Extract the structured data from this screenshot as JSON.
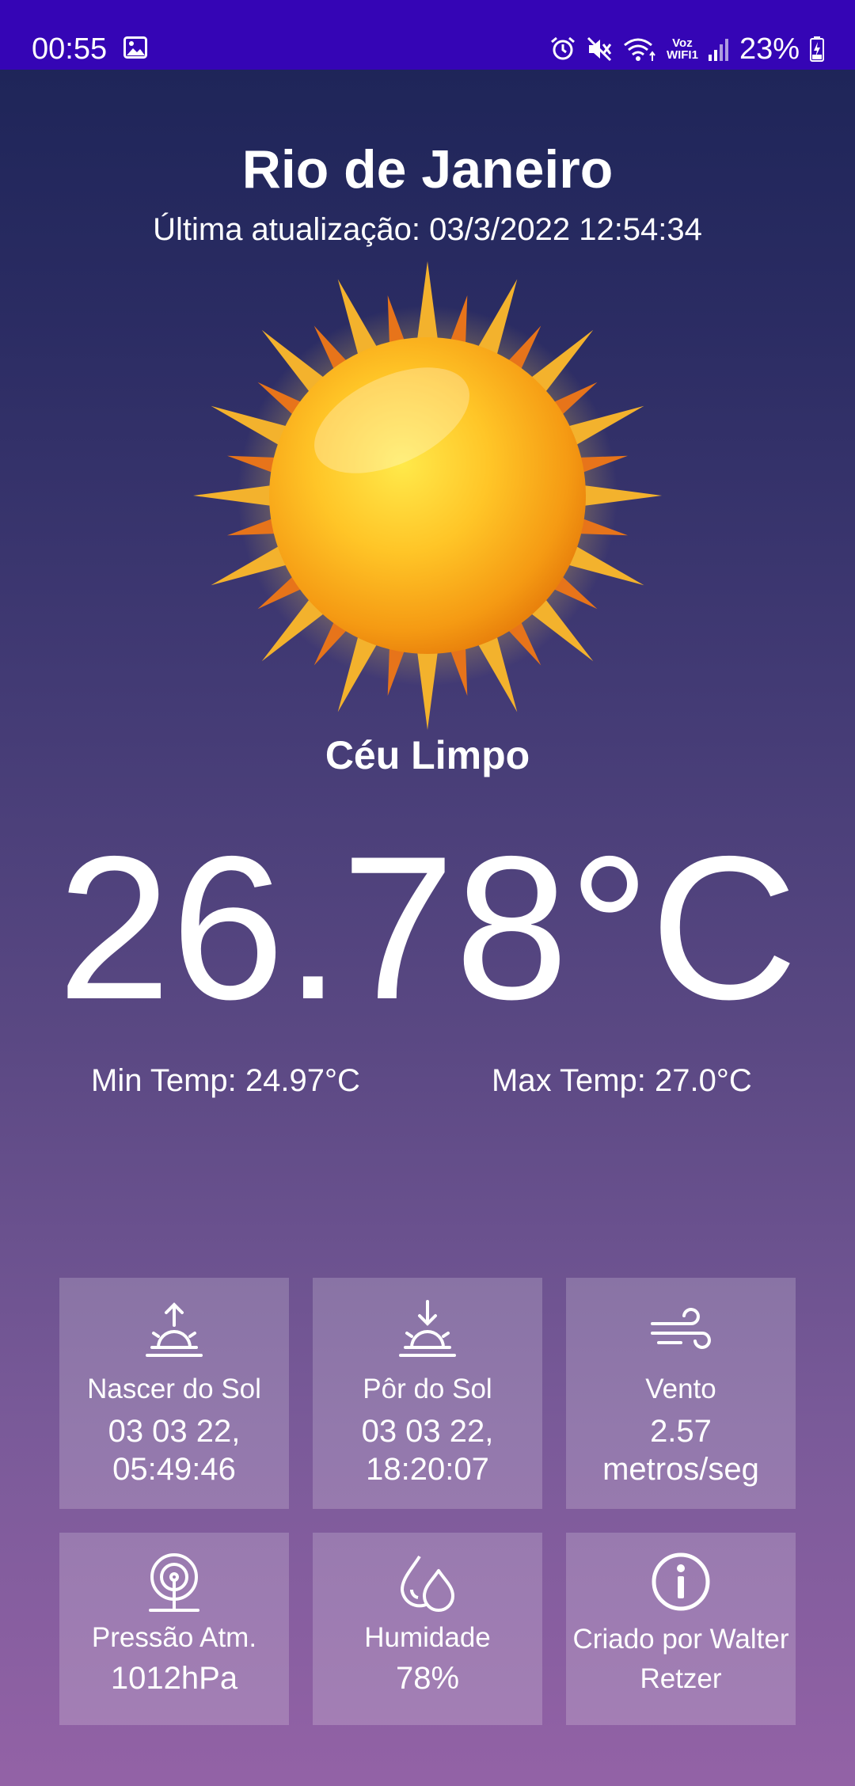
{
  "status_bar": {
    "time": "00:55",
    "voz_line1": "Voz",
    "voz_line2": "WIFI1",
    "battery": "23%",
    "icons": [
      "gallery-icon",
      "alarm-icon",
      "mute-icon",
      "wifi-icon",
      "signal-icon",
      "battery-icon"
    ]
  },
  "location": {
    "city": "Rio de Janeiro",
    "last_update": "Última atualização: 03/3/2022 12:54:34"
  },
  "weather": {
    "icon": "sun-icon",
    "condition": "Céu Limpo",
    "temperature": "26.78°C",
    "min_temp": "Min Temp: 24.97°C",
    "max_temp": "Max Temp: 27.0°C"
  },
  "details": [
    {
      "icon": "sunrise-icon",
      "label": "Nascer do Sol",
      "value": "03 03 22, 05:49:46"
    },
    {
      "icon": "sunset-icon",
      "label": "Pôr do Sol",
      "value": "03 03 22, 18:20:07"
    },
    {
      "icon": "wind-icon",
      "label": "Vento",
      "value": "2.57 metros/seg"
    },
    {
      "icon": "pressure-icon",
      "label": "Pressão Atm.",
      "value": "1012hPa"
    },
    {
      "icon": "humidity-icon",
      "label": "Humidade",
      "value": "78%"
    },
    {
      "icon": "info-icon",
      "label": "Criado por Walter Retzer",
      "value": ""
    }
  ],
  "colors": {
    "status_bar": "#3505b5",
    "background_top": "#1b2356",
    "background_bottom": "#9362a6",
    "tile": "rgba(255,255,255,0.19)",
    "text": "#ffffff"
  }
}
